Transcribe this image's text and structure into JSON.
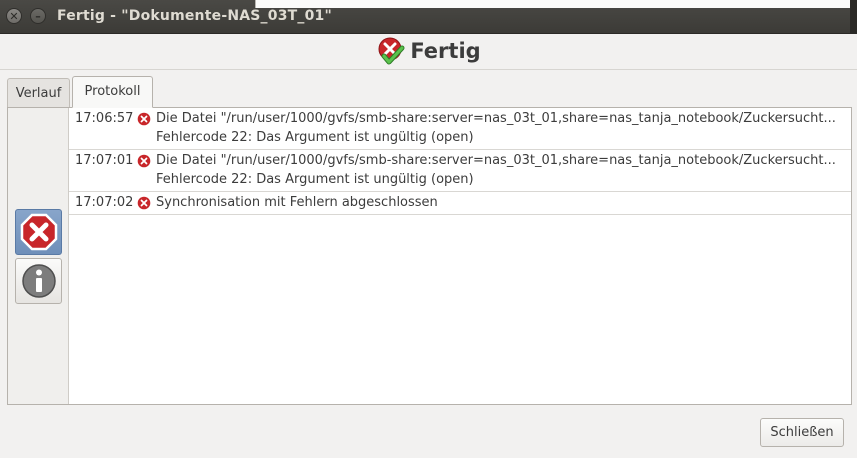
{
  "window": {
    "title": "Fertig - \"Dokumente-NAS_03T_01\"",
    "close_glyph": "✕",
    "minimize_glyph": "–"
  },
  "header": {
    "title": "Fertig",
    "icon": "error-check-icon"
  },
  "tabs": [
    {
      "label": "Verlauf",
      "active": false
    },
    {
      "label": "Protokoll",
      "active": true
    }
  ],
  "sidebar": {
    "buttons": [
      {
        "icon": "error-filter-icon",
        "pressed": true
      },
      {
        "icon": "info-filter-icon",
        "pressed": false
      }
    ]
  },
  "log": {
    "entries": [
      {
        "time": "17:06:57",
        "icon": "error-icon",
        "message": "Die Datei \"/run/user/1000/gvfs/smb-share:server=nas_03t_01,share=nas_tanja_notebook/Zuckersucht...",
        "detail": "Fehlercode 22: Das Argument ist ungültig (open)"
      },
      {
        "time": "17:07:01",
        "icon": "error-icon",
        "message": "Die Datei \"/run/user/1000/gvfs/smb-share:server=nas_03t_01,share=nas_tanja_notebook/Zuckersucht...",
        "detail": "Fehlercode 22: Das Argument ist ungültig (open)"
      },
      {
        "time": "17:07:02",
        "icon": "error-icon",
        "message": "Synchronisation mit Fehlern abgeschlossen",
        "detail": ""
      }
    ]
  },
  "footer": {
    "close_label": "Schließen"
  },
  "colors": {
    "error_red": "#c8262a",
    "check_green": "#3fa535",
    "titlebar": "#3c3b37",
    "selection_blue": "#7a98c2"
  }
}
